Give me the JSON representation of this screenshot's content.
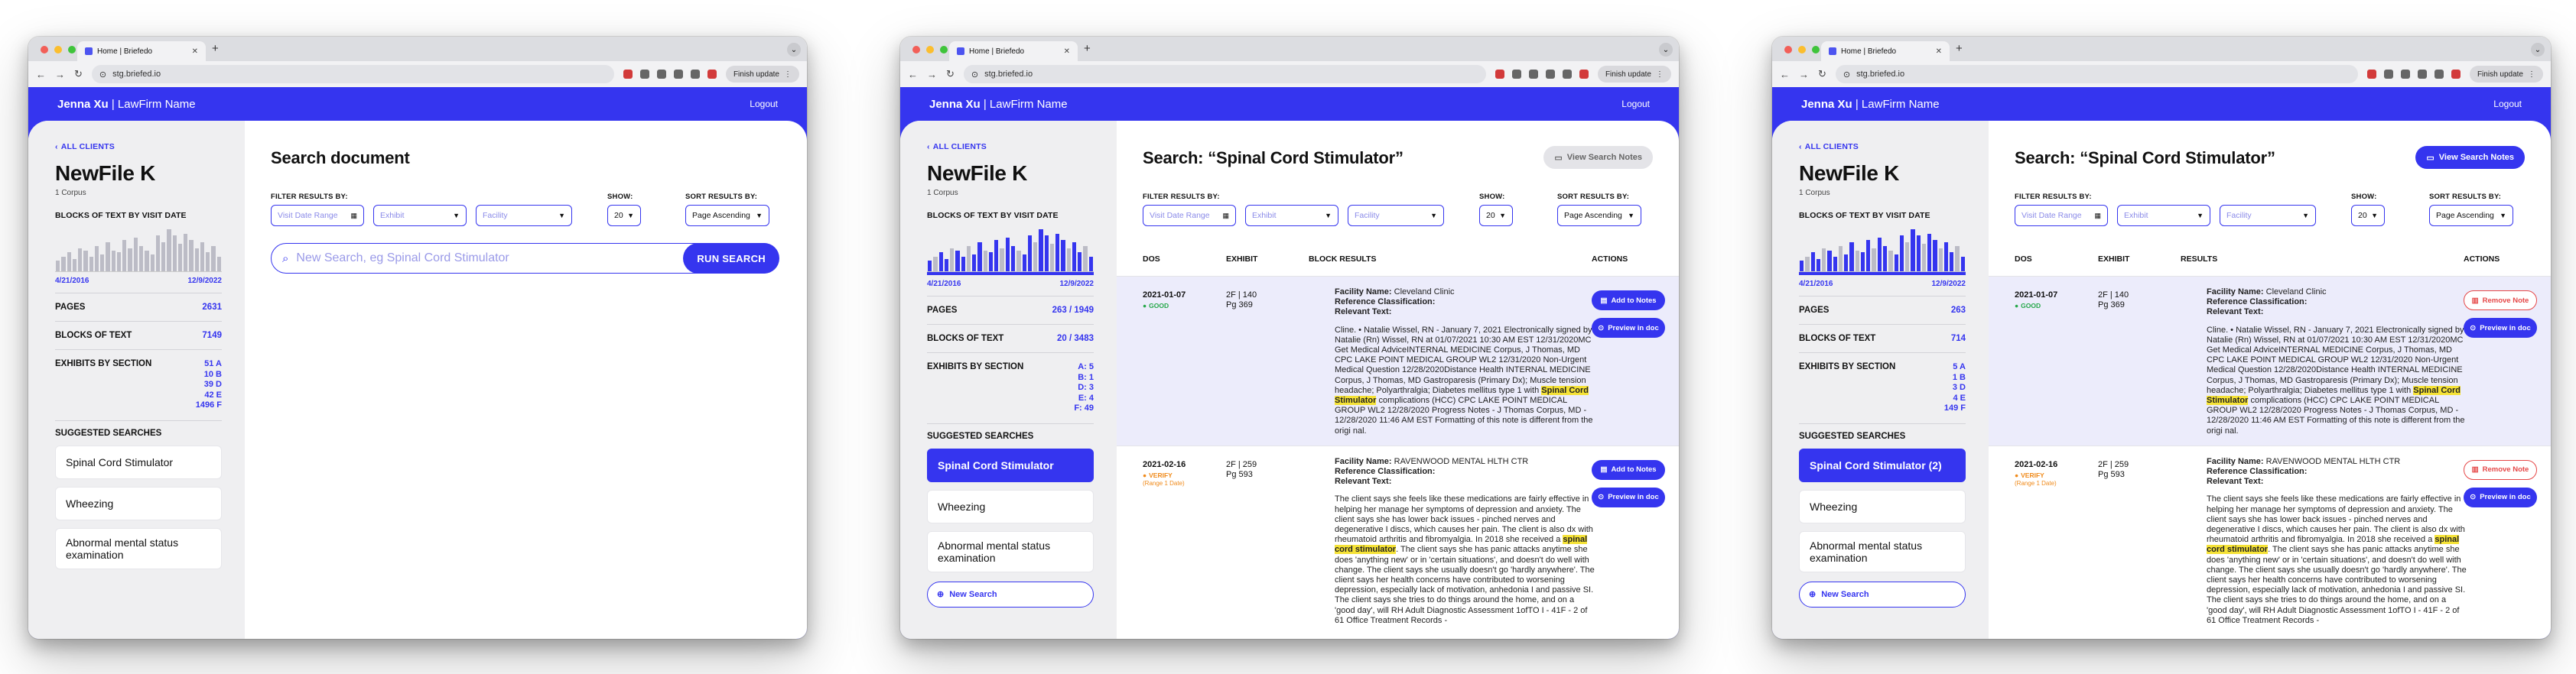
{
  "browser": {
    "tab_title": "Home | Briefedo",
    "url": "stg.briefed.io",
    "finish_update": "Finish update"
  },
  "app": {
    "user": "Jenna Xu",
    "firm": "| LawFirm Name",
    "logout": "Logout",
    "back": "ALL CLIENTS",
    "file_title": "NewFile K",
    "corpus": "1 Corpus",
    "blocks_heading": "BLOCKS OF TEXT BY VISIT DATE",
    "range_start": "4/21/2016",
    "range_end": "12/9/2022",
    "pages_label": "PAGES",
    "blocks_label": "BLOCKS OF TEXT",
    "exhibits_label": "EXHIBITS BY SECTION",
    "suggested_label": "SUGGESTED SEARCHES",
    "new_search": "New Search"
  },
  "filters": {
    "label": "FILTER RESULTS BY:",
    "visit_date": "Visit Date Range",
    "exhibit": "Exhibit",
    "facility": "Facility",
    "show_label": "SHOW:",
    "show_value": "20",
    "sort_label": "SORT RESULTS BY:",
    "sort_value": "Page Ascending"
  },
  "histogram": {
    "values": [
      0.25,
      0.35,
      0.45,
      0.3,
      0.55,
      0.5,
      0.35,
      0.6,
      0.4,
      0.7,
      0.5,
      0.45,
      0.75,
      0.55,
      0.8,
      0.6,
      0.5,
      0.4,
      0.85,
      0.7,
      1.0,
      0.85,
      0.65,
      0.9,
      0.75,
      0.55,
      0.7,
      0.45,
      0.6,
      0.35
    ]
  },
  "win1": {
    "title": "Search document",
    "pages": "2631",
    "blocks": "7149",
    "sections": [
      "51 A",
      "10 B",
      "39 D",
      "42 E",
      "1496 F"
    ],
    "suggestions": [
      "Spinal Cord Stimulator",
      "Wheezing",
      "Abnormal mental status examination"
    ],
    "search_placeholder": "New Search, eg Spinal Cord Stimulator",
    "run": "RUN SEARCH"
  },
  "win2": {
    "title": "Search: “Spinal Cord Stimulator”",
    "view_notes": "View Search Notes",
    "pages": "263 / 1949",
    "blocks": "20 / 3483",
    "sections": [
      "A: 5",
      "B: 1",
      "D: 3",
      "E: 4",
      "F: 49"
    ],
    "suggestions": [
      "Spinal Cord Stimulator",
      "Wheezing",
      "Abnormal mental status examination"
    ],
    "columns": [
      "DOS",
      "EXHIBIT",
      "BLOCK RESULTS",
      "ACTIONS"
    ],
    "actions": [
      "Add to Notes",
      "Preview in doc"
    ]
  },
  "win3": {
    "title": "Search: “Spinal Cord Stimulator”",
    "view_notes": "View Search Notes",
    "pages": "263",
    "blocks": "714",
    "sections": [
      "5 A",
      "1 B",
      "3 D",
      "4 E",
      "149 F"
    ],
    "suggestions": [
      "Spinal Cord Stimulator (2)",
      "Wheezing",
      "Abnormal mental status examination"
    ],
    "columns": [
      "DOS",
      "EXHIBIT",
      "RESULTS",
      "ACTIONS"
    ],
    "actions": [
      "Remove Note",
      "Preview in doc"
    ]
  },
  "results": [
    {
      "dos": "2021-01-07",
      "status": "GOOD",
      "range": "",
      "exhibit": "2F | 140",
      "page": "Pg 369",
      "facility_label": "Facility Name:",
      "facility": "Cleveland Clinic",
      "refclass": "Reference Classification:",
      "relevant": "Relevant Text:",
      "pre": "Cline. • Natalie Wissel, RN - January 7, 2021 Electronically signed by Natalie (Rn) Wissel, RN at 01/07/2021 10:30 AM EST 12/31/2020MC Get Medical AdviceINTERNAL MEDICINE Corpus, J Thomas, MD CPC LAKE POINT MEDICAL GROUP WL2 12/31/2020 Non-Urgent Medical Question 12/28/2020Distance Health INTERNAL MEDICINE Corpus, J Thomas, MD Gastroparesis (Primary Dx); Muscle tension headache; Polyarthralgia; Diabetes mellitus type 1 with ",
      "hl": "Spinal Cord Stimulator",
      "post": " complications (HCC) CPC LAKE POINT MEDICAL GROUP WL2 12/28/2020 Progress Notes - J Thomas Corpus, MD - 12/28/2020 11:46 AM EST Formatting of this note is different from the origi nal."
    },
    {
      "dos": "2021-02-16",
      "status": "VERIFY",
      "range": "(Range 1 Date)",
      "exhibit": "2F | 259",
      "page": "Pg 593",
      "facility_label": "Facility Name:",
      "facility": "RAVENWOOD MENTAL HLTH CTR",
      "refclass": "Reference Classification:",
      "relevant": "Relevant Text:",
      "pre": "The client says she feels like these medications are fairly effective in helping her manage her symptoms of depression and anxiety. The client says she has lower back issues - pinched nerves and degenerative I discs, which causes her pain. The client is also dx with rheumatoid arthritis and fibromyalgia. In 2018 she received a ",
      "hl": "spinal cord stimulator",
      "post": ". The client says she has panic attacks anytime she does 'anything new' or in 'certain situations', and doesn't do well with change. The client says she usually doesn't go 'hardly anywhere'. The client says her health concerns have contributed to worsening depression, especially lack of motivation, anhedonia I and passive SI. The client says she tries to do things around the home, and on a 'good day', will RH Adult Diagnostic Assessment 1ofTO I - 41F - 2 of 61 Office Treatment Records -"
    }
  ]
}
